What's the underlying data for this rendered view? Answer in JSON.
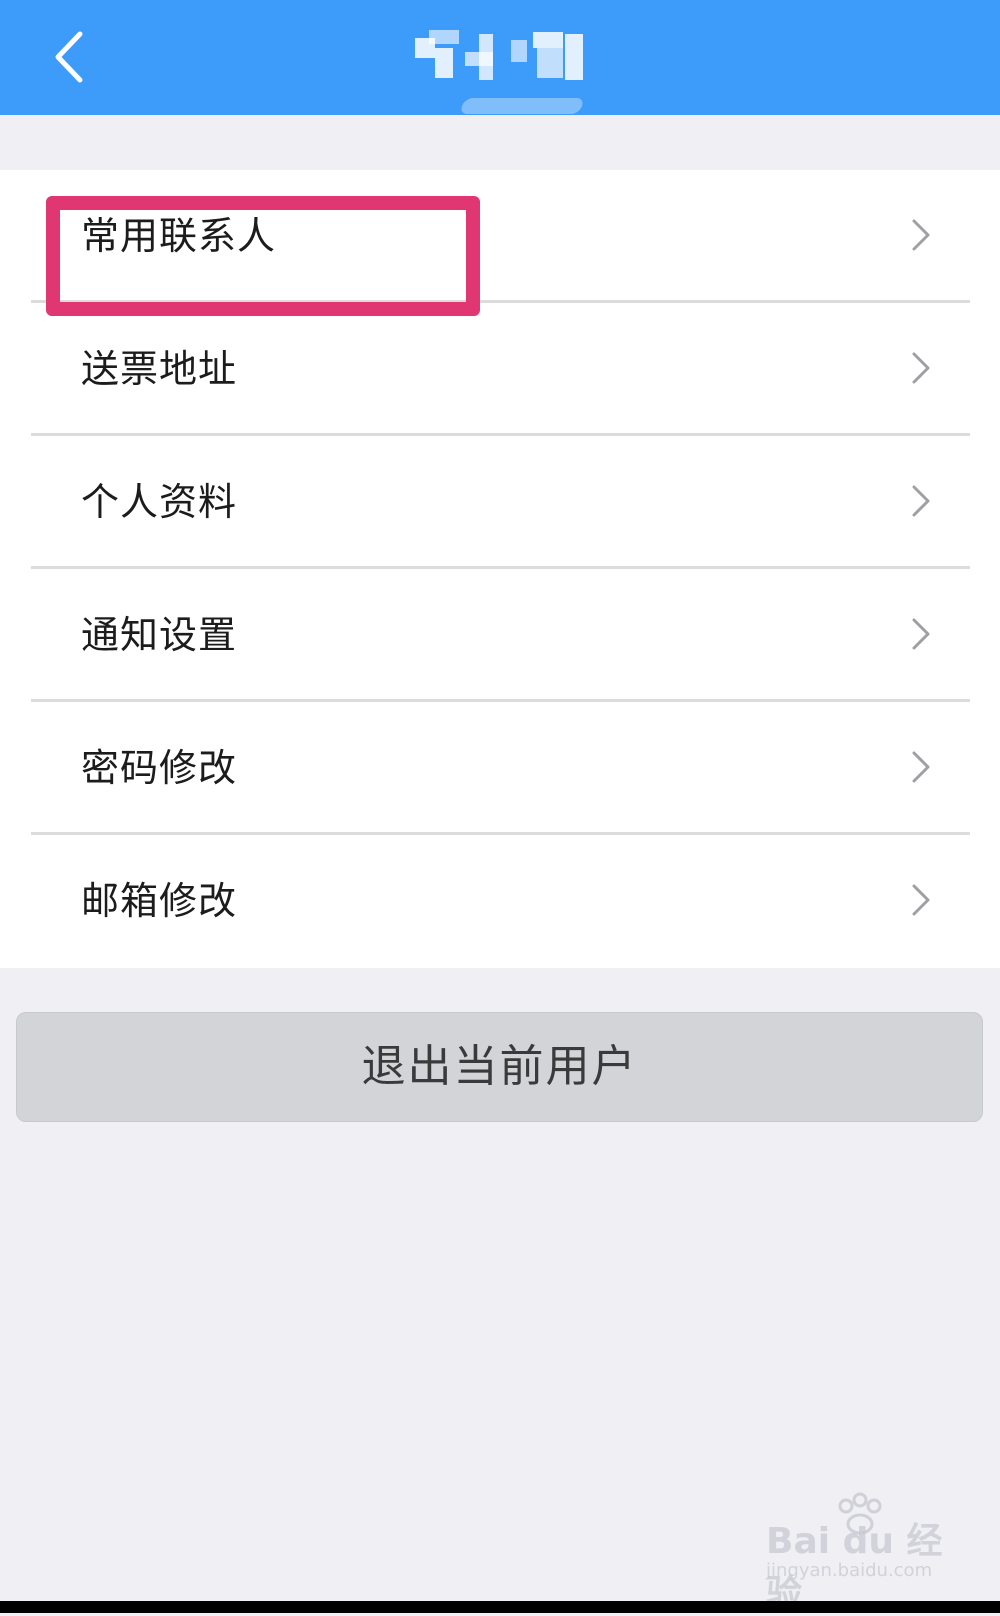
{
  "header": {
    "title": "",
    "back_icon": "chevron-left-icon",
    "background_color": "#3d9bf9"
  },
  "menu": {
    "items": [
      {
        "label": "常用联系人",
        "icon": "chevron-right-icon"
      },
      {
        "label": "送票地址",
        "icon": "chevron-right-icon"
      },
      {
        "label": "个人资料",
        "icon": "chevron-right-icon"
      },
      {
        "label": "通知设置",
        "icon": "chevron-right-icon"
      },
      {
        "label": "密码修改",
        "icon": "chevron-right-icon"
      },
      {
        "label": "邮箱修改",
        "icon": "chevron-right-icon"
      }
    ],
    "highlighted_item": "常用联系人",
    "highlight_color": "#e03672"
  },
  "logout": {
    "label": "退出当前用户"
  },
  "watermark": {
    "main": "Bai du 经验",
    "sub": "jingyan.baidu.com"
  }
}
